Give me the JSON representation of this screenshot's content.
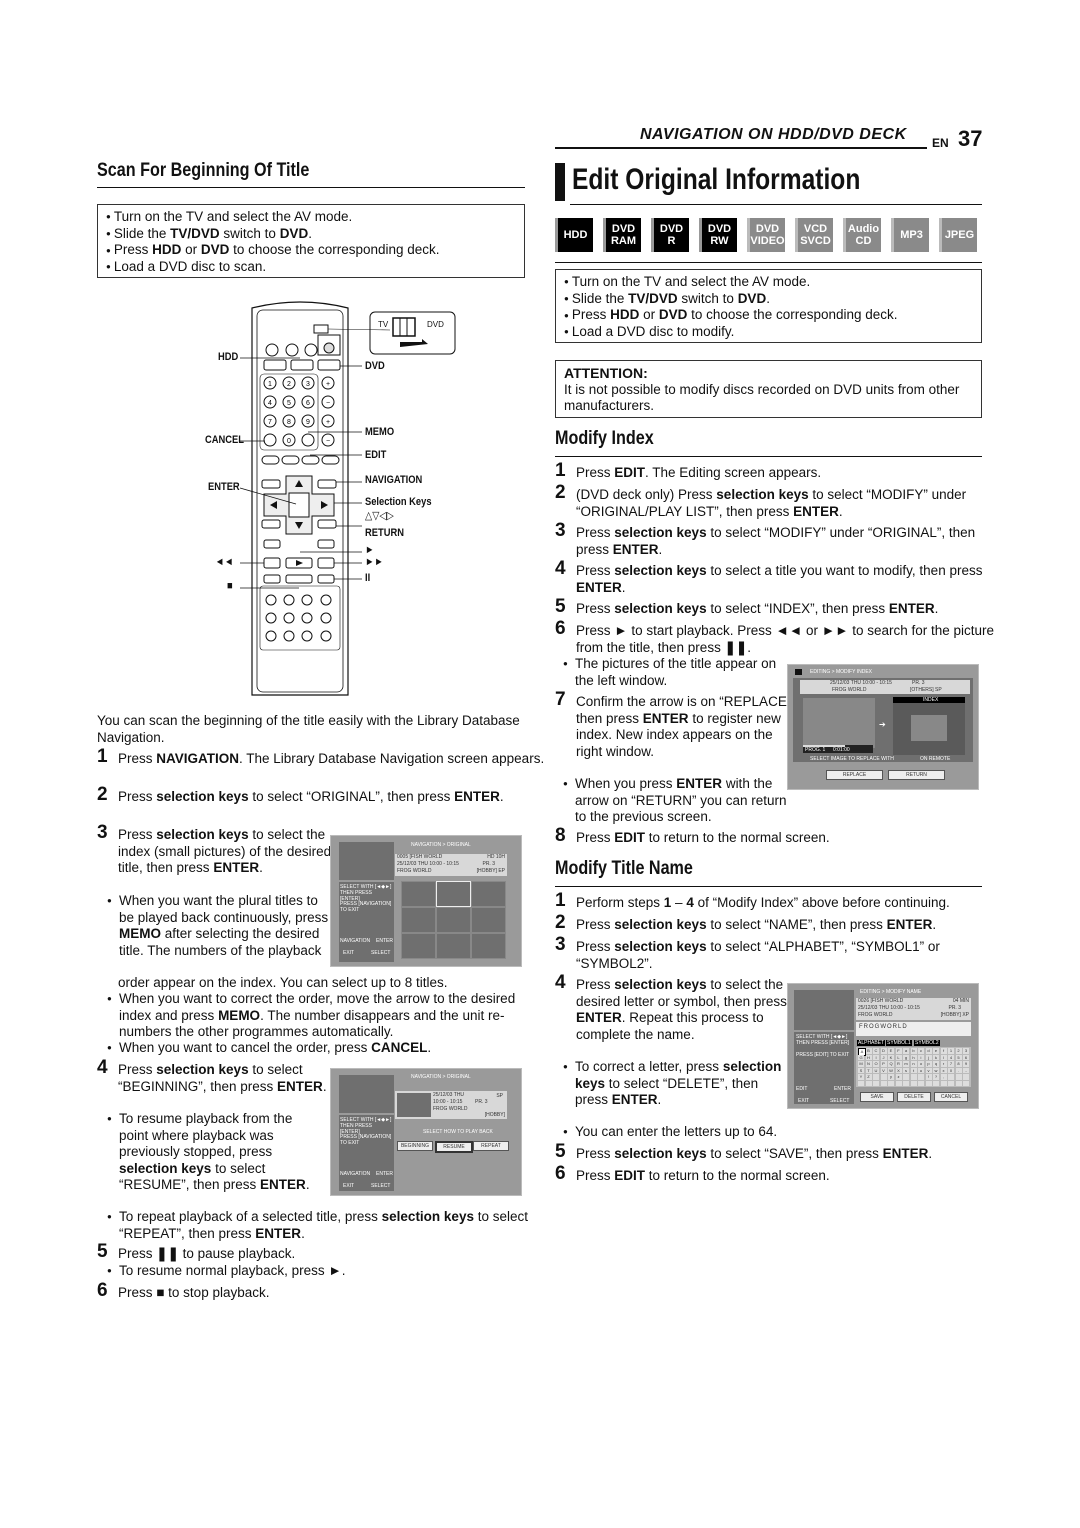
{
  "header": {
    "running_head": "NAVIGATION ON HDD/DVD DECK",
    "lang": "EN",
    "page_number": "37"
  },
  "left": {
    "title": "Scan For Beginning Of Title",
    "prereq": [
      "Turn on the TV and select the AV mode.",
      "Slide the TV/DVD switch to DVD.",
      "Press HDD or DVD to choose the corresponding deck.",
      "Load a DVD disc to scan."
    ],
    "remote": {
      "switch_tv": "TV",
      "switch_dvd": "DVD",
      "labels": {
        "hdd": "HDD",
        "cancel": "CANCEL",
        "enter": "ENTER",
        "rew": "◄◄",
        "stop": "■",
        "dvd": "DVD",
        "memo": "MEMO",
        "edit": "EDIT",
        "navigation": "NAVIGATION",
        "selection_keys": "Selection Keys",
        "arrows": "△▽◁▷",
        "return": "RETURN",
        "play": "►",
        "ff": "►►",
        "pause": "II"
      },
      "numbers": [
        "1",
        "2",
        "3",
        "4",
        "5",
        "6",
        "7",
        "8",
        "9",
        "0"
      ]
    },
    "intro": "You can scan the beginning of the title easily with the Library Database Navigation.",
    "steps": [
      {
        "num": "1",
        "html": "Press <b>NAVIGATION</b>. The Library Database Navigation screen appears."
      },
      {
        "num": "2",
        "html": "Press <b>selection keys</b> to select “ORIGINAL”, then press <b>ENTER</b>."
      },
      {
        "num": "3",
        "html": "Press <b>selection keys</b> to select the index (small pictures) of the desired title, then press <b>ENTER</b>."
      },
      {
        "num": "4",
        "html": "Press <b>selection keys</b> to select “BEGINNING”, then press <b>ENTER</b>."
      },
      {
        "num": "5",
        "html": "Press <b>❚❚</b> to pause playback."
      },
      {
        "num": "6",
        "html": "Press <b>■</b> to stop playback."
      }
    ],
    "step3_notes": [
      "When you want the plural titles to be played back continuously, press <b>MEMO</b> after selecting the desired title. The numbers of the playback",
      "order appear on the index. You can select up to 8 titles.",
      "When you want to correct the order, move the arrow to the desired index and press <b>MEMO</b>. The number disappears and the unit re-numbers the other programmes automatically.",
      "When you want to cancel the order, press <b>CANCEL</b>."
    ],
    "step4_notes": [
      "To resume playback from the point where playback was previously stopped, press <b>selection keys</b> to select “RESUME”, then press <b>ENTER</b>.",
      "To repeat playback of a selected title, press <b>selection keys</b> to select “REPEAT”, then press <b>ENTER</b>."
    ],
    "step5_note": "To resume normal playback, press ►.",
    "osd_nav_index": {
      "title": "NAVIGATION > ORIGINAL",
      "row1_left": "0005 [FISH WORLD",
      "row1_right": "HD 10H",
      "row2_left": "25/12/03 THU 10:00 - 10:15",
      "row2_right": "PR. 3",
      "row3_left": "FROG WORLD",
      "row3_right": "[HOBBY] EP",
      "help1": "SELECT WITH [◄◆►] THEN PRESS [ENTER]",
      "help2": "PRESS [NAVIGATION] TO EXIT",
      "nav": "NAVIGATION",
      "enter": "ENTER",
      "exit": "EXIT",
      "select": "SELECT"
    },
    "osd_nav_play": {
      "title": "NAVIGATION > ORIGINAL",
      "date": "25/12/03 THU",
      "mode": "SP",
      "time": "10:00 - 10:15",
      "pr": "PR. 3",
      "name": "FROG WORLD",
      "genre": "[HOBBY]",
      "prompt": "SELECT HOW TO PLAY BACK",
      "buttons": [
        "BEGINNING",
        "RESUME",
        "REPEAT"
      ],
      "help1": "SELECT WITH [◄◆►] THEN PRESS [ENTER]",
      "help2": "PRESS [NAVIGATION] TO EXIT",
      "nav": "NAVIGATION",
      "enter": "ENTER",
      "exit": "EXIT",
      "select": "SELECT"
    }
  },
  "right": {
    "title": "Edit Original Information",
    "badges": [
      {
        "label": "HDD",
        "active": true
      },
      {
        "label": "DVD RAM",
        "active": true
      },
      {
        "label": "DVD R",
        "active": true
      },
      {
        "label": "DVD RW",
        "active": true
      },
      {
        "label": "DVD VIDEO",
        "active": false
      },
      {
        "label": "VCD SVCD",
        "active": false
      },
      {
        "label": "Audio CD",
        "active": false
      },
      {
        "label": "MP3",
        "active": false
      },
      {
        "label": "JPEG",
        "active": false
      }
    ],
    "prereq": [
      "Turn on the TV and select the AV mode.",
      "Slide the TV/DVD switch to DVD.",
      "Press HDD or DVD to choose the corresponding deck.",
      "Load a DVD disc to modify."
    ],
    "attention_title": "ATTENTION:",
    "attention_text": "It is not possible to modify discs recorded on DVD units from other manufacturers.",
    "modify_index": {
      "title": "Modify Index",
      "steps": [
        {
          "num": "1",
          "html": "Press <b>EDIT</b>. The Editing screen appears."
        },
        {
          "num": "2",
          "html": "(DVD deck only) Press <b>selection keys</b> to select “MODIFY” under “ORIGINAL/PLAY LIST”, then press <b>ENTER</b>."
        },
        {
          "num": "3",
          "html": "Press <b>selection keys</b> to select “MODIFY” under “ORIGINAL”, then press <b>ENTER</b>."
        },
        {
          "num": "4",
          "html": "Press <b>selection keys</b> to select a title you want to modify, then press <b>ENTER</b>."
        },
        {
          "num": "5",
          "html": "Press <b>selection keys</b> to select “INDEX”, then press <b>ENTER</b>."
        },
        {
          "num": "6",
          "html": "Press <b>►</b> to start playback. Press <b>◄◄</b> or <b>►►</b> to search for the picture from the title, then press <b>❚❚</b>."
        },
        {
          "num": "7",
          "html": "Confirm the arrow is on “REPLACE”, then press <b>ENTER</b> to register new index. New index appears on the right window."
        },
        {
          "num": "8",
          "html": "Press <b>EDIT</b> to return to the normal screen."
        }
      ],
      "note6": "The pictures of the title appear on the left window.",
      "note7": "When you press <b>ENTER</b> with the arrow on “RETURN” you can return to the previous screen.",
      "osd": {
        "title": "EDITING > MODIFY INDEX",
        "row1_left": "25/12/03 THU 10:00 - 10:15",
        "row1_right": "PR. 3",
        "row2_left": "FROG WORLD",
        "row2_right": "[OTHERS] SP",
        "index_label": "INDEX",
        "prog": "PROG. 1",
        "time": "0:01:00",
        "hint": "SELECT IMAGE TO REPLACE WITH",
        "hint2": "ON REMOTE",
        "replace": "REPLACE",
        "return": "RETURN"
      }
    },
    "modify_name": {
      "title": "Modify Title Name",
      "steps": [
        {
          "num": "1",
          "html": "Perform steps <b>1</b> – <b>4</b> of “Modify Index” above before continuing."
        },
        {
          "num": "2",
          "html": "Press <b>selection keys</b> to select “NAME”, then press <b>ENTER</b>."
        },
        {
          "num": "3",
          "html": "Press <b>selection keys</b> to select “ALPHABET”, “SYMBOL1” or “SYMBOL2”."
        },
        {
          "num": "4",
          "html": "Press <b>selection keys</b> to select the desired letter or symbol, then press <b>ENTER</b>. Repeat this process to complete the name."
        },
        {
          "num": "5",
          "html": "Press <b>selection keys</b> to select “SAVE”, then press <b>ENTER</b>."
        },
        {
          "num": "6",
          "html": "Press <b>EDIT</b> to return to the normal screen."
        }
      ],
      "note4a": "To correct a letter, press <b>selection keys</b> to select “DELETE”, then press <b>ENTER</b>.",
      "note4b": "You can enter the letters up to 64.",
      "osd": {
        "title": "EDITING > MODIFY NAME",
        "row1_left": "0026 [FISH WORLD",
        "row1_right": "04 MIN",
        "row2_left": "25/12/03 THU 10:00 - 10:15",
        "row2_right": "PR. 3",
        "row3_left": "FROG WORLD",
        "row3_right": "[HOBBY] XP",
        "name_value": "FROGWORLD",
        "tabs": [
          "ALPHABET",
          "SYMBOL1",
          "SYMBOL2"
        ],
        "help1": "SELECT WITH [◄◆►] THEN PRESS [ENTER]",
        "help2": "PRESS [EDIT] TO EXIT",
        "edit": "EDIT",
        "enter": "ENTER",
        "exit": "EXIT",
        "select": "SELECT",
        "buttons": [
          "SAVE",
          "DELETE",
          "CANCEL"
        ],
        "keys": "ABCDEFabcdef123GHIJKLghijkl456MNOPQRmnopqr789STUVWXstuvwx0.-YZ  yz   !?,"
      }
    }
  }
}
